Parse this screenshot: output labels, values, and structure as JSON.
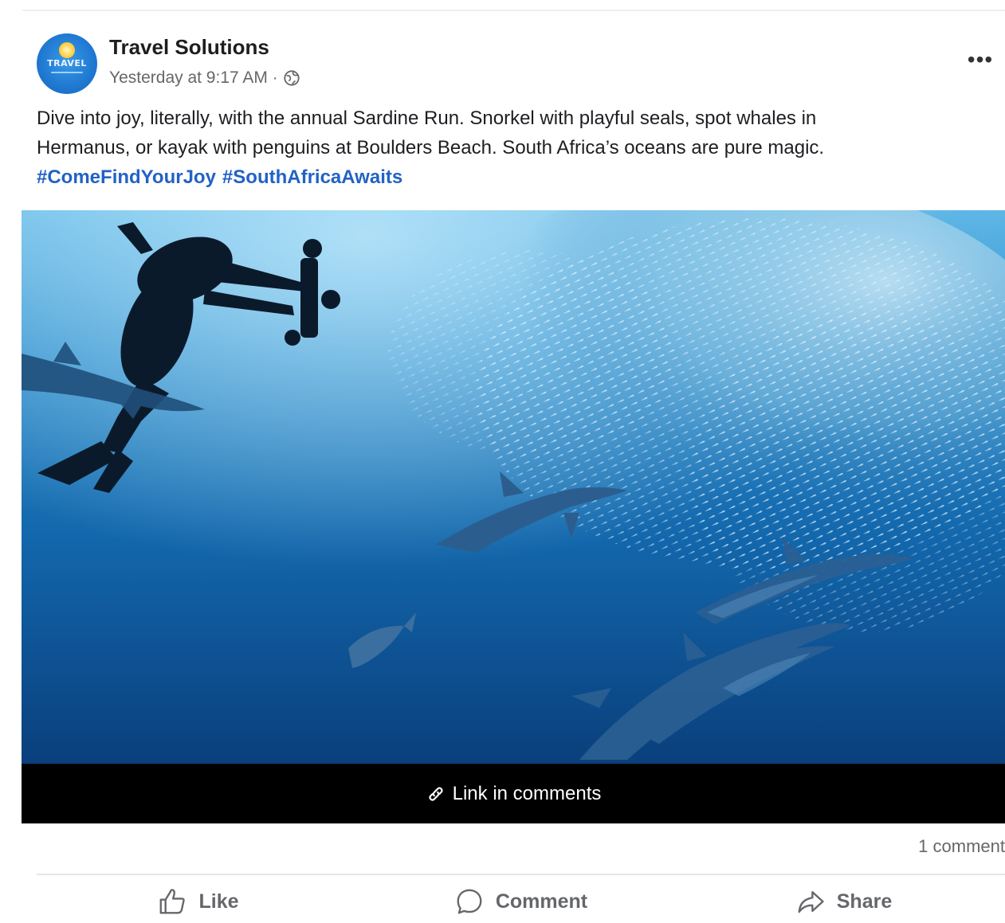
{
  "post": {
    "page_name": "Travel Solutions",
    "avatar_text": "TRAVEL",
    "timestamp": "Yesterday at 9:17 AM",
    "separator": "·",
    "privacy_icon": "globe-icon",
    "more_label": "•••",
    "body_line1": "Dive into joy, literally, with the annual Sardine Run. Snorkel with playful seals, spot whales in",
    "body_line2": "Hermanus, or kayak with penguins at Boulders Beach. South Africa’s oceans are pure magic.",
    "hashtags": [
      "#ComeFindYourJoy",
      "#SouthAfricaAwaits"
    ],
    "link_caption": "Link in comments",
    "link_icon": "link-icon",
    "comments_count": "1 comment"
  },
  "actions": {
    "like": "Like",
    "comment": "Comment",
    "share": "Share"
  },
  "colors": {
    "hashtag": "#2262c6",
    "meta_text": "#65676b",
    "caption_bar": "#000000",
    "ocean_deep": "#0d4a8a",
    "ocean_light": "#3aa2d8"
  }
}
